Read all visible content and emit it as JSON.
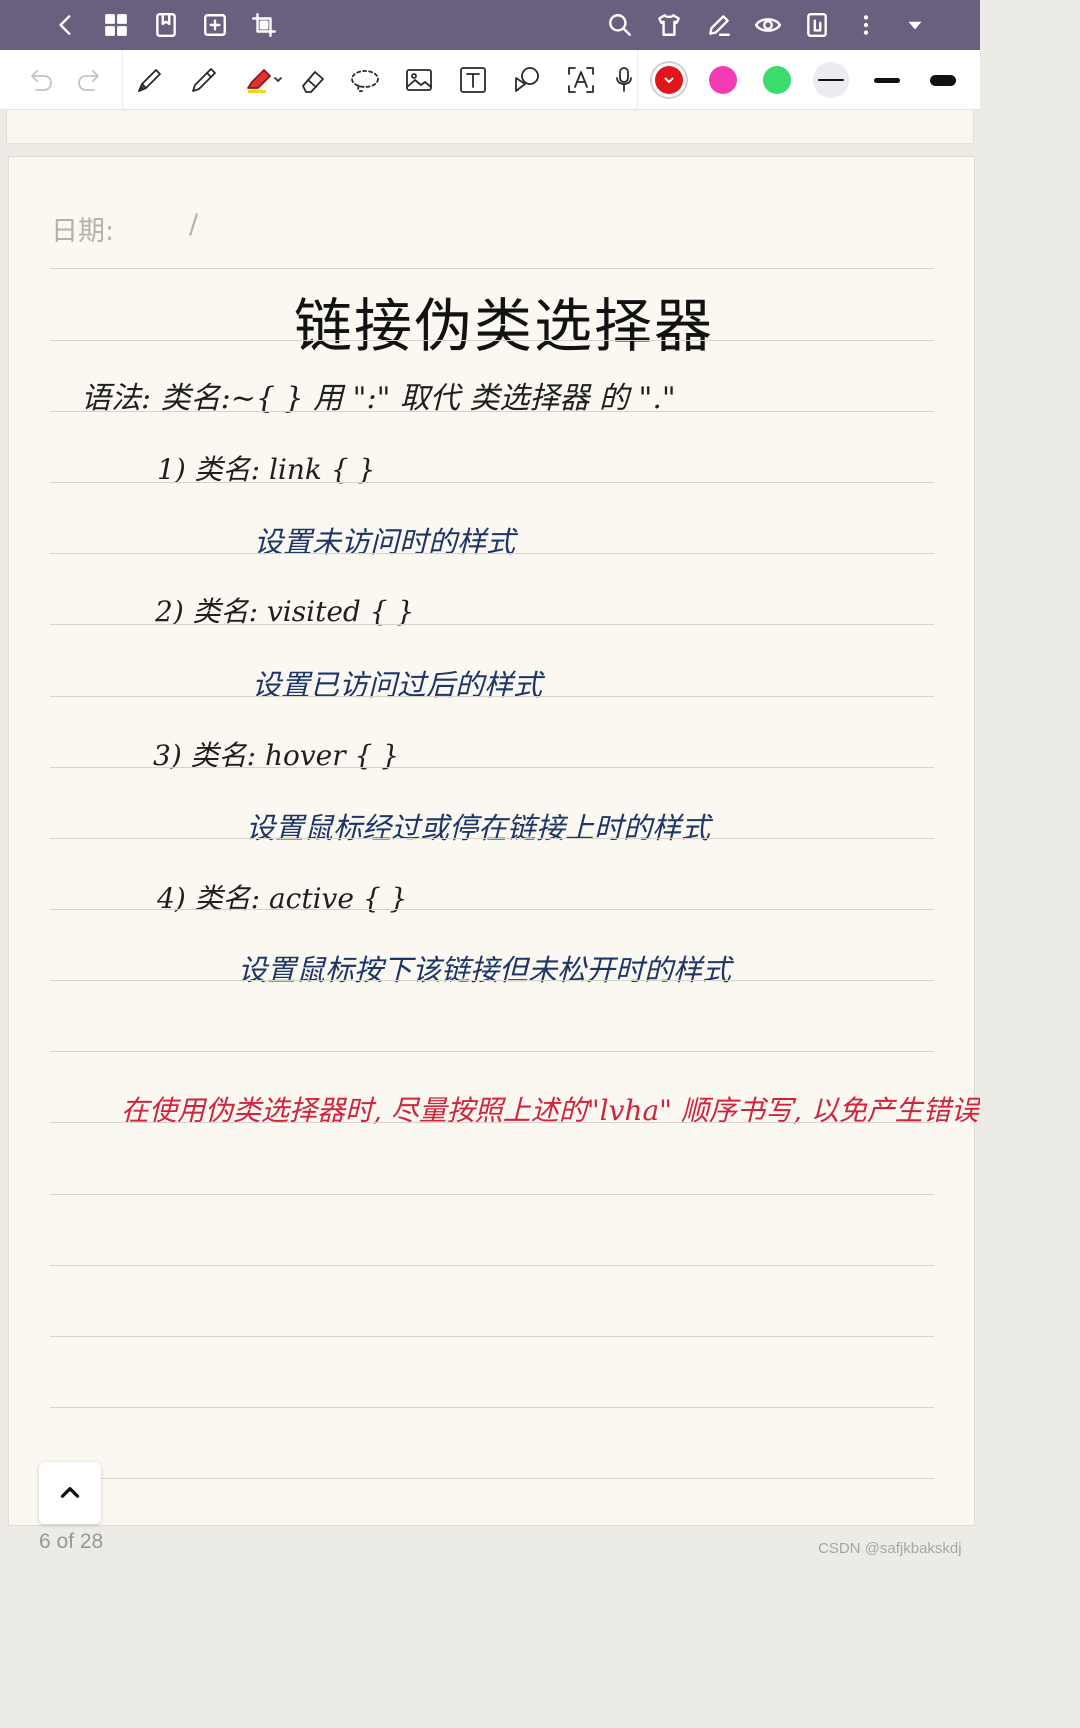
{
  "topbar": {
    "icons": [
      "back-icon",
      "grid-icon",
      "bookmark-icon",
      "add-page-icon",
      "crop-icon",
      "search-icon",
      "shirt-icon",
      "pen-edit-icon",
      "eye-icon",
      "layout-icon",
      "more-vertical-icon",
      "dropdown-triangle-icon"
    ],
    "background": "#6a5f7e"
  },
  "toolbar": {
    "tools": [
      "undo-icon",
      "redo-icon",
      "fountain-pen-icon",
      "ballpoint-pen-icon",
      "highlighter-icon",
      "eraser-icon",
      "lasso-icon",
      "image-icon",
      "text-box-icon",
      "shape-icon",
      "text-recognition-icon",
      "microphone-icon"
    ],
    "colors": [
      "#e1161c",
      "#f43bb4",
      "#3cdc6c"
    ],
    "selected_color": "#e1161c",
    "thickness_levels": [
      "thin",
      "medium",
      "thick"
    ]
  },
  "page": {
    "date_label": "日期:",
    "date_separator": "/",
    "title": "链接伪类选择器",
    "syntax_line": "语法: 类名:~{ }   用 \":\" 取代 类选择器 的 \".\"",
    "items": [
      {
        "selector": "1) 类名: link { }",
        "description": "设置未访问时的样式"
      },
      {
        "selector": "2) 类名: visited { }",
        "description": "设置已访问过后的样式"
      },
      {
        "selector": "3) 类名: hover { }",
        "description": "设置鼠标经过或停在链接上时的样式"
      },
      {
        "selector": "4) 类名: active { }",
        "description": "设置鼠标按下该链接但未松开时的样式"
      }
    ],
    "note": "在使用伪类选择器时, 尽量按照上述的\"lvha\" 顺序书写, 以免产生错误",
    "ink_colors": {
      "black": "#1f1f1f",
      "blue": "#1e3567",
      "red": "#d1243c"
    }
  },
  "footer": {
    "page_counter": "6 of 28",
    "watermark": "CSDN @safjkbakskdj"
  }
}
